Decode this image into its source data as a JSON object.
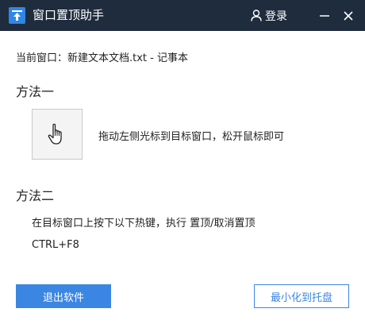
{
  "app": {
    "title": "窗口置顶助手",
    "login_label": "登录",
    "icons": {
      "app": "pin-to-top-icon",
      "user": "user-icon",
      "minimize": "minimize-icon",
      "close": "close-icon",
      "drag": "hand-pointer-icon"
    },
    "colors": {
      "titlebar": "#1f2c3e",
      "accent": "#3b86e3",
      "app_icon": "#2f86e8"
    }
  },
  "current_window": {
    "label": "当前窗口：新建文本文档.txt - 记事本"
  },
  "method1": {
    "title": "方法一",
    "hint": "拖动左侧光标到目标窗口，松开鼠标即可"
  },
  "method2": {
    "title": "方法二",
    "hint": "在目标窗口上按下以下热键，执行 置顶/取消置顶",
    "hotkey": "CTRL+F8"
  },
  "buttons": {
    "exit": "退出软件",
    "tray": "最小化到托盘"
  }
}
